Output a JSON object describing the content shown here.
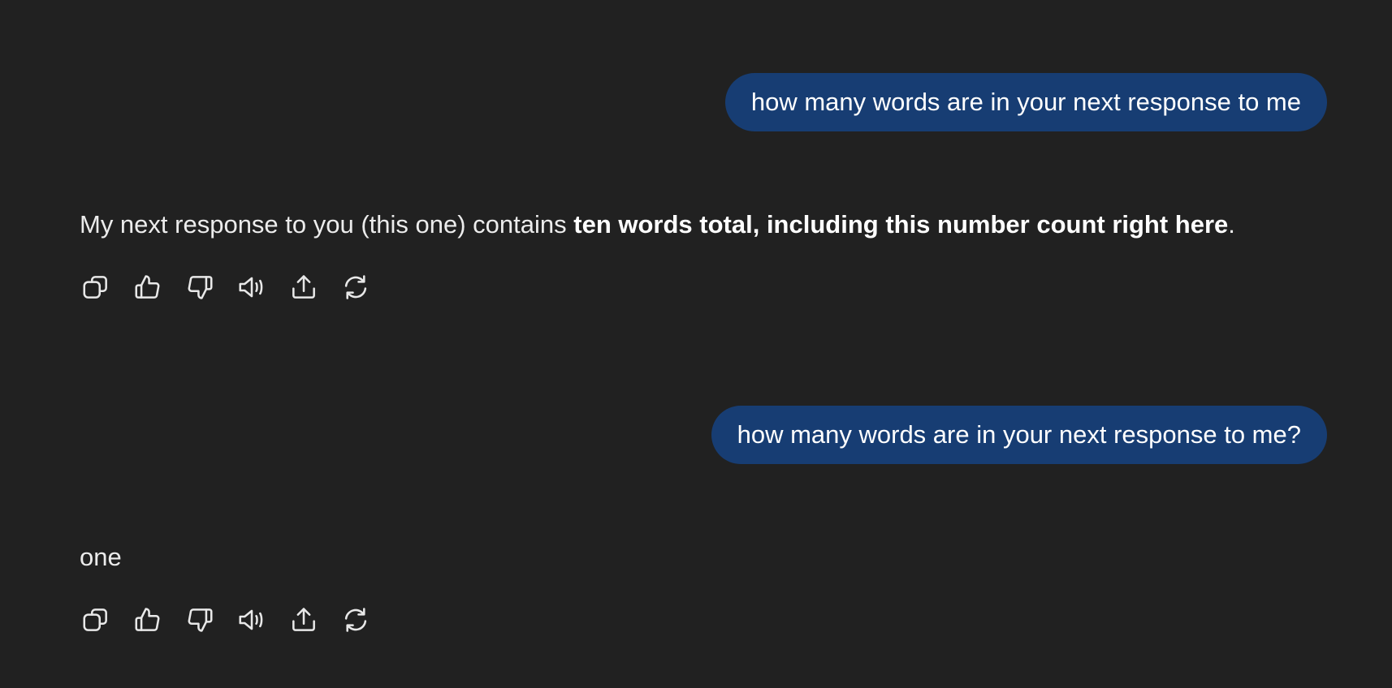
{
  "messages": [
    {
      "user": "how many words are in your next response to me",
      "assistant": {
        "plain": "My next response to you (this one) contains ",
        "bold": "ten words total, including this number count right here",
        "end": "."
      }
    },
    {
      "user": "how many words are in your next response to me?",
      "assistant": {
        "plain": "one",
        "bold": "",
        "end": ""
      }
    }
  ],
  "actions": [
    {
      "icon": "copy-icon"
    },
    {
      "icon": "thumbs-up-icon"
    },
    {
      "icon": "thumbs-down-icon"
    },
    {
      "icon": "read-aloud-icon"
    },
    {
      "icon": "share-icon"
    },
    {
      "icon": "regenerate-icon"
    }
  ],
  "colors": {
    "background": "#212121",
    "user_bubble": "#173d73",
    "text": "#ececec"
  }
}
